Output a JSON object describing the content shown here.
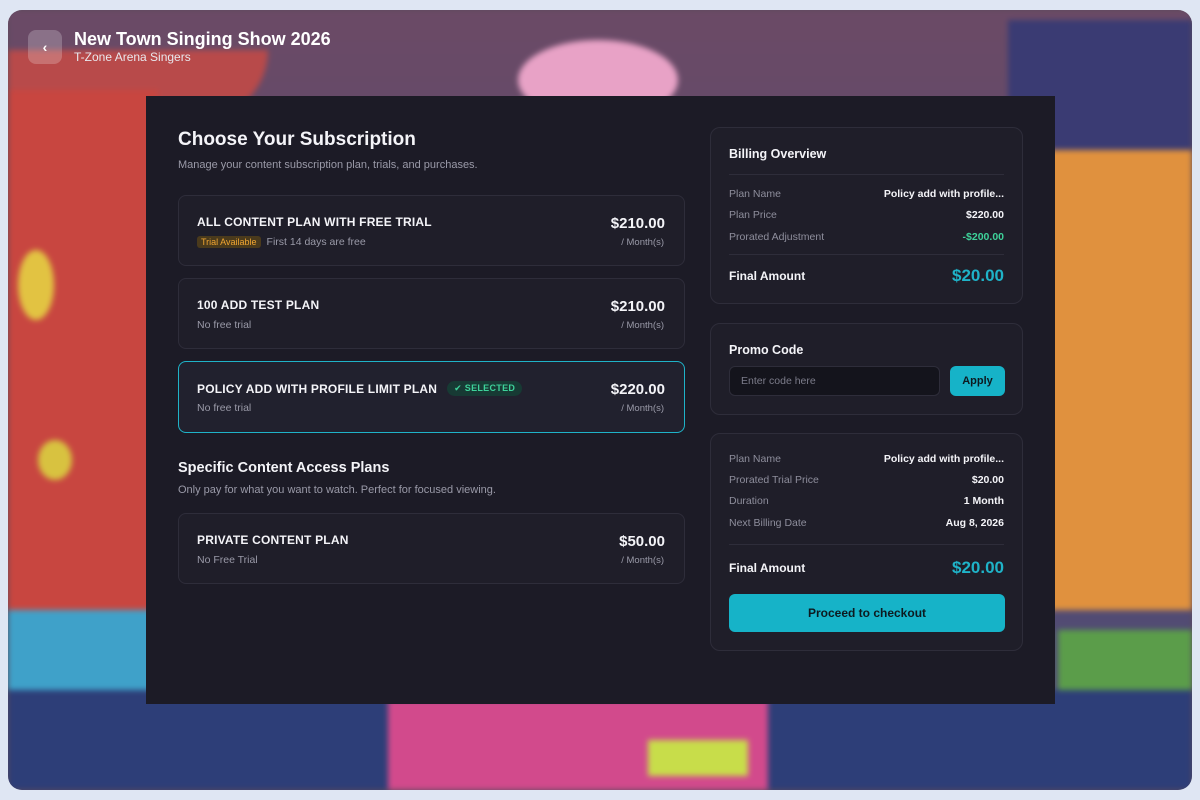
{
  "header": {
    "back_icon": "chevron-left-icon",
    "back_glyph": "‹",
    "title": "New Town Singing Show 2026",
    "subtitle": "T-Zone Arena Singers"
  },
  "subscription": {
    "title": "Choose Your Subscription",
    "subtitle": "Manage your content subscription plan, trials, and purchases.",
    "plans": [
      {
        "name": "ALL CONTENT PLAN WITH FREE TRIAL",
        "badge": "Trial Available",
        "description": "First 14 days are free",
        "price": "$210.00",
        "period": "/ Month(s)"
      },
      {
        "name": "100 ADD TEST PLAN",
        "description": "No free trial",
        "price": "$210.00",
        "period": "/ Month(s)"
      },
      {
        "name": "POLICY ADD WITH PROFILE LIMIT PLAN",
        "selected_label": "✔ SELECTED",
        "description": "No free trial",
        "price": "$220.00",
        "period": "/ Month(s)",
        "selected": true
      }
    ]
  },
  "specific": {
    "title": "Specific Content Access Plans",
    "subtitle": "Only pay for what you want to watch. Perfect for focused viewing.",
    "plans": [
      {
        "name": "PRIVATE CONTENT PLAN",
        "description": "No Free Trial",
        "price": "$50.00",
        "period": "/ Month(s)"
      }
    ]
  },
  "billing": {
    "title": "Billing Overview",
    "rows": [
      {
        "label": "Plan Name",
        "value": "Policy add with profile..."
      },
      {
        "label": "Plan Price",
        "value": "$220.00"
      },
      {
        "label": "Prorated Adjustment",
        "value": "-$200.00"
      }
    ],
    "final_label": "Final Amount",
    "final_value": "$20.00"
  },
  "promo": {
    "title": "Promo Code",
    "placeholder": "Enter code here",
    "apply_label": "Apply"
  },
  "summary": {
    "rows": [
      {
        "label": "Plan Name",
        "value": "Policy add with profile..."
      },
      {
        "label": "Prorated Trial Price",
        "value": "$20.00"
      },
      {
        "label": "Duration",
        "value": "1 Month"
      },
      {
        "label": "Next Billing Date",
        "value": "Aug 8, 2026"
      }
    ],
    "final_label": "Final Amount",
    "final_value": "$20.00",
    "checkout_label": "Proceed to checkout"
  },
  "colors": {
    "accent": "#16b3c8",
    "panel": "#1c1b26",
    "positive": "#3ed29a",
    "trial": "#f0a531"
  }
}
